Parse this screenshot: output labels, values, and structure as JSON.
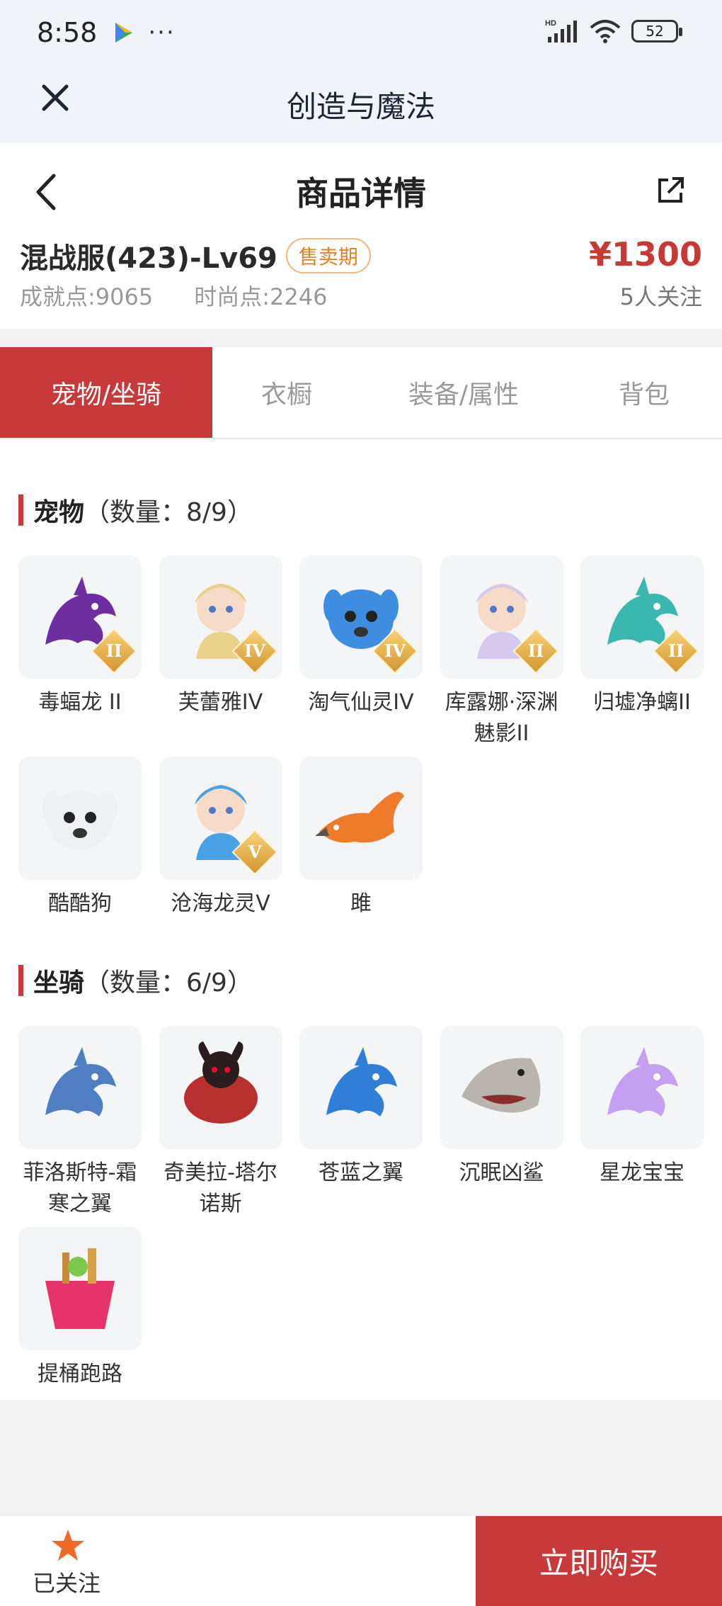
{
  "status_bar": {
    "time": "8:58",
    "dots": "···",
    "battery": "52",
    "network": "HD"
  },
  "mini_app": {
    "title": "创造与魔法"
  },
  "header": {
    "title": "商品详情"
  },
  "product": {
    "server_name": "混战服(423)-Lv69",
    "status_badge": "售卖期",
    "price": "¥1300",
    "achievement_label": "成就点:",
    "achievement_value": "9065",
    "fashion_label": "时尚点:",
    "fashion_value": "2246",
    "followers": "5人关注"
  },
  "tabs": [
    {
      "label": "宠物/坐骑",
      "active": true
    },
    {
      "label": "衣橱",
      "active": false
    },
    {
      "label": "装备/属性",
      "active": false
    },
    {
      "label": "背包",
      "active": false
    }
  ],
  "pets": {
    "title": "宠物",
    "count": "（数量：8/9）",
    "items": [
      {
        "name": "毒蝠龙 II",
        "tier": "II",
        "icon": "dragon-icon",
        "color": "#6d2fa0"
      },
      {
        "name": "芙蕾雅IV",
        "tier": "IV",
        "icon": "character-icon",
        "color": "#e9d28a"
      },
      {
        "name": "淘气仙灵IV",
        "tier": "IV",
        "icon": "dog-icon",
        "color": "#3d8de0"
      },
      {
        "name": "库露娜·深渊魅影II",
        "tier": "II",
        "icon": "character-icon",
        "color": "#d7c8ee"
      },
      {
        "name": "归墟净螭II",
        "tier": "II",
        "icon": "dragon-icon",
        "color": "#3ab8b0"
      },
      {
        "name": "酷酷狗",
        "tier": "",
        "icon": "dog-icon",
        "color": "#eef0f4"
      },
      {
        "name": "沧海龙灵V",
        "tier": "V",
        "icon": "character-icon",
        "color": "#4aa2e6"
      },
      {
        "name": "雎",
        "tier": "",
        "icon": "bird-icon",
        "color": "#ef7a2a"
      }
    ]
  },
  "mounts": {
    "title": "坐骑",
    "count": "（数量：6/9）",
    "items": [
      {
        "name": "菲洛斯特-霜寒之翼",
        "tier": "",
        "icon": "dragon-icon",
        "color": "#4f7fc2"
      },
      {
        "name": "奇美拉-塔尔诺斯",
        "tier": "",
        "icon": "beast-icon",
        "color": "#b82f2f"
      },
      {
        "name": "苍蓝之翼",
        "tier": "",
        "icon": "dragon-icon",
        "color": "#2f7fd8"
      },
      {
        "name": "沉眠凶鲨",
        "tier": "",
        "icon": "shark-icon",
        "color": "#b9b4ae"
      },
      {
        "name": "星龙宝宝",
        "tier": "",
        "icon": "dragon-icon",
        "color": "#c59ff0"
      },
      {
        "name": "提桶跑路",
        "tier": "",
        "icon": "bucket-icon",
        "color": "#e6336b"
      }
    ]
  },
  "bottom_bar": {
    "follow_label": "已关注",
    "buy_label": "立即购买"
  },
  "colors": {
    "accent": "#c7393a",
    "price": "#c63a33",
    "badge": "#e57f28"
  }
}
